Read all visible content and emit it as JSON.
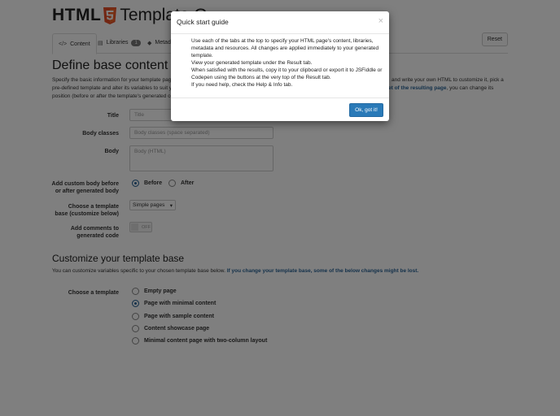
{
  "header": {
    "brand_html": "HTML",
    "brand_rest": "Template G"
  },
  "tabs": [
    {
      "label": "Content",
      "icon": "code-icon"
    },
    {
      "label": "Libraries",
      "icon": "book-icon",
      "badge": "1"
    },
    {
      "label": "Metad",
      "icon": "tag-icon"
    }
  ],
  "reset_label": "Reset",
  "define": {
    "title": "Define base content for",
    "intro_1": "Specify the basic information for your template page",
    "intro_1_right": "and write your own HTML to customize it, pick a",
    "intro_2": "pre-defined template and alter its variables to suit yo",
    "intro_2_right": "et of the resulting page",
    "intro_2_right_tail": ", you can change its",
    "intro_3": "position (before or after the template's generated co"
  },
  "form": {
    "title_label": "Title",
    "title_placeholder": "Title",
    "body_classes_label": "Body classes",
    "body_classes_placeholder": "Body classes (space separated)",
    "body_label": "Body",
    "body_placeholder": "Body (HTML)",
    "position_label": "Add custom body before or after generated body",
    "before": "Before",
    "after": "After",
    "base_label": "Choose a template base (customize below)",
    "base_value": "Simple pages",
    "comments_label": "Add comments to generated code",
    "comments_state": "OFF"
  },
  "customize": {
    "title": "Customize your template base",
    "desc": "You can customize variables specific to your chosen template base below.",
    "warn": "If you change your template base, some of the below changes might be lost.",
    "choose_label": "Choose a template",
    "templates": [
      "Empty page",
      "Page with minimal content",
      "Page with sample content",
      "Content showcase page",
      "Minimal content page with two-column layout"
    ]
  },
  "modal": {
    "title": "Quick start guide",
    "close": "×",
    "items": [
      "Use each of the tabs at the top to specify your HTML page's content, libraries,",
      "metadata and resources. All changes are applied immediately to your generated",
      "template.",
      "View your generated template under the Result tab.",
      "When satisfied with the results, copy it to your clipboard or export it to JSFiddle or",
      "Codepen using the buttons at the very top of the Result tab.",
      "If you need help, check the Help & Info tab."
    ],
    "ok": "Ok, got it!"
  },
  "colors": {
    "accent": "#2a7ab8",
    "link": "#2a6496",
    "html5": "#e44d26"
  }
}
